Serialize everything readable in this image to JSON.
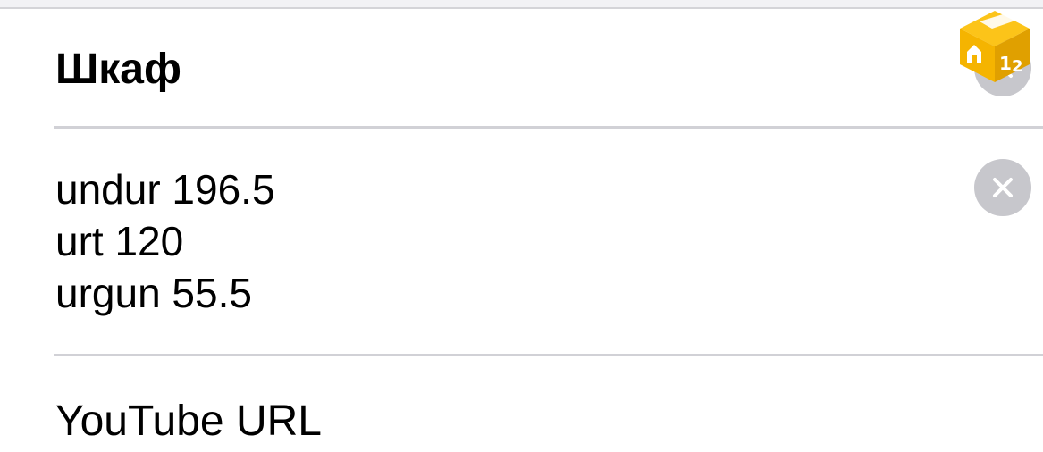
{
  "form": {
    "title": "Шкаф",
    "notes_lines": [
      "undur 196.5",
      "urt 120",
      "urgun 55.5"
    ],
    "url_placeholder": "YouTube URL"
  },
  "icons": {
    "clear_title": "close-icon",
    "clear_notes": "close-icon",
    "badge": "package-box-icon"
  },
  "colors": {
    "clear_button": "#c7c7cc",
    "badge_primary": "#f5b400",
    "divider": "#d1d1d6"
  }
}
